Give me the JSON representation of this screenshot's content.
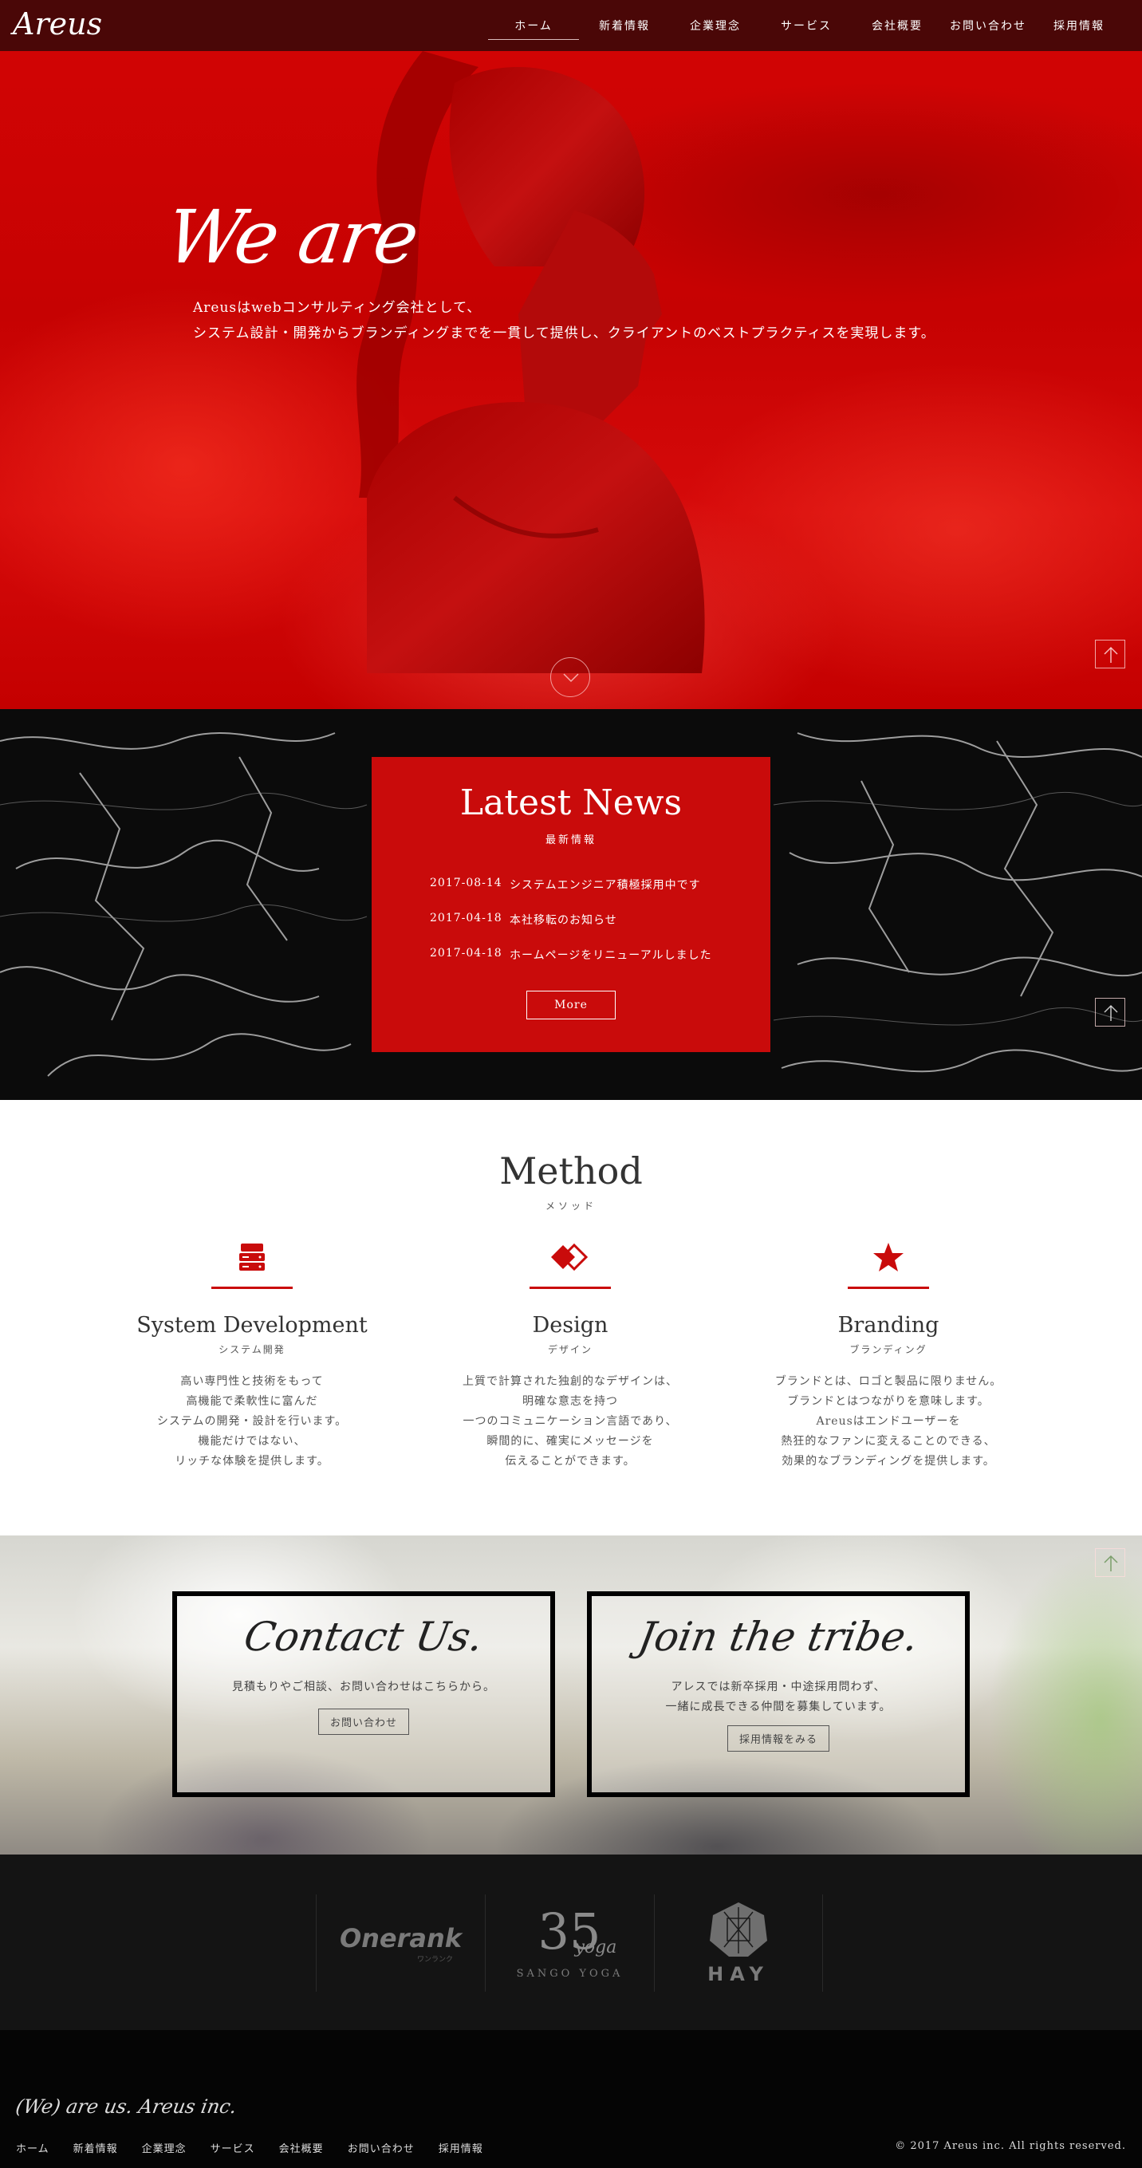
{
  "brand": {
    "logo": "Areus",
    "accent": "#c90b0b",
    "nav_bg": "#4a0707"
  },
  "nav": {
    "items": [
      {
        "label": "ホーム",
        "active": true
      },
      {
        "label": "新着情報"
      },
      {
        "label": "企業理念"
      },
      {
        "label": "サービス"
      },
      {
        "label": "会社概要"
      },
      {
        "label": "お問い合わせ"
      },
      {
        "label": "採用情報"
      }
    ]
  },
  "hero": {
    "title": "We are",
    "line1": "Areusはwebコンサルティング会社として、",
    "line2": "システム設計・開発からブランディングまでを一貫して提供し、クライアントのベストプラクティスを実現します。"
  },
  "news": {
    "title": "Latest News",
    "subtitle": "最新情報",
    "items": [
      {
        "date": "2017-08-14",
        "text": "システムエンジニア積極採用中です"
      },
      {
        "date": "2017-04-18",
        "text": "本社移転のお知らせ"
      },
      {
        "date": "2017-04-18",
        "text": "ホームページをリニューアルしました"
      }
    ],
    "more_label": "More"
  },
  "method": {
    "title": "Method",
    "subtitle": "メソッド",
    "columns": [
      {
        "icon": "server-icon",
        "title": "System Development",
        "subtitle": "システム開発",
        "lines": [
          "高い専門性と技術をもって",
          "高機能で柔軟性に富んだ",
          "システムの開発・設計を行います。",
          "機能だけではない、",
          "リッチな体験を提供します。"
        ]
      },
      {
        "icon": "diamond-icon",
        "title": "Design",
        "subtitle": "デザイン",
        "lines": [
          "上質で計算された独創的なデザインは、",
          "明確な意志を持つ",
          "一つのコミュニケーション言語であり、",
          "瞬間的に、確実にメッセージを",
          "伝えることができます。"
        ]
      },
      {
        "icon": "star-icon",
        "title": "Branding",
        "subtitle": "ブランディング",
        "lines": [
          "ブランドとは、ロゴと製品に限りません。",
          "ブランドとはつながりを意味します。",
          "Areusはエンドユーザーを",
          "熱狂的なファンに変えることのできる、",
          "効果的なブランディングを提供します。"
        ]
      }
    ]
  },
  "contact": {
    "left": {
      "script": "Contact Us.",
      "text": "見積もりやご相談、お問い合わせはこちらから。",
      "button": "お問い合わせ"
    },
    "right": {
      "script": "Join the tribe.",
      "line1": "アレスでは新卒採用・中途採用問わず、",
      "line2": "一緒に成長できる仲間を募集しています。",
      "button": "採用情報をみる"
    }
  },
  "partners": {
    "onerank": {
      "name": "Onerank",
      "tagline": "ワンランク"
    },
    "sango": {
      "number": "35",
      "script": "yoga",
      "name": "SANGO YOGA"
    },
    "hay": {
      "name": "HAY"
    }
  },
  "footer": {
    "script": "(We) are us. Areus inc.",
    "links": [
      "ホーム",
      "新着情報",
      "企業理念",
      "サービス",
      "会社概要",
      "お問い合わせ",
      "採用情報"
    ],
    "copyright": "© 2017 Areus inc. All rights reserved."
  }
}
